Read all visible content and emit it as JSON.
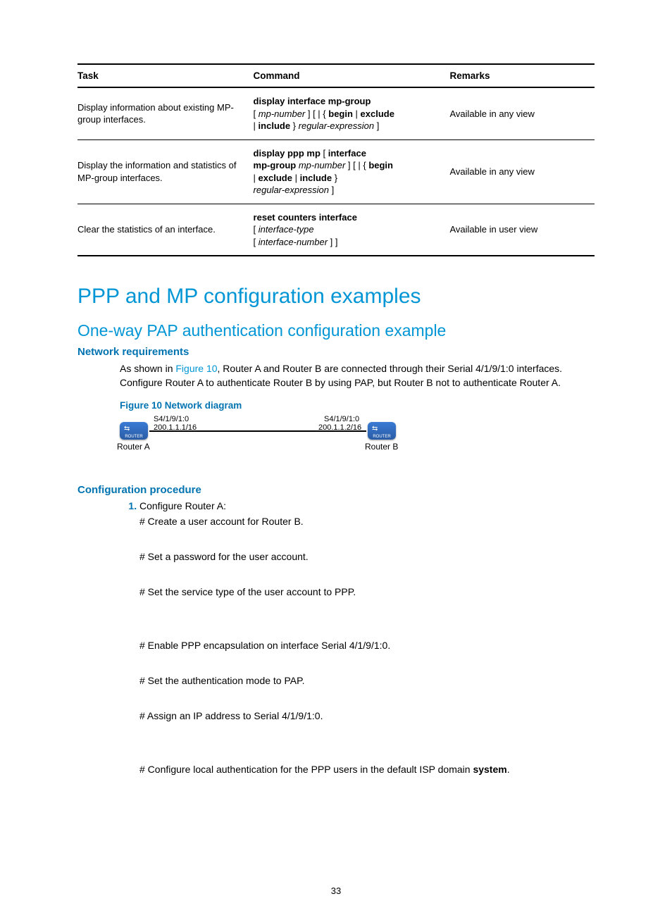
{
  "table": {
    "headers": [
      "Task",
      "Command",
      "Remarks"
    ],
    "rows": [
      {
        "task": "Display information about existing MP-group interfaces.",
        "remarks": "Available in any view",
        "cmd": {
          "p1b": "display interface mp-group",
          "p2a": "[ ",
          "p2i": "mp-number",
          "p2b": " ] [ | { ",
          "p2c": "begin",
          "p2d": " | ",
          "p2e": "exclude",
          "p3a": " | ",
          "p3b": "include",
          "p3c": " } ",
          "p3i": "regular-expression",
          "p3d": " ]"
        }
      },
      {
        "task": "Display the information and statistics of MP-group interfaces.",
        "remarks": "Available in any view",
        "cmd": {
          "p1b": "display ppp mp",
          "p1c": " [ ",
          "p1d": "interface",
          "p2a": "mp-group",
          "p2b": " ",
          "p2i": "mp-number",
          "p2c": " ] [ | { ",
          "p2d": "begin",
          "p3a": " | ",
          "p3b": "exclude",
          "p3c": " | ",
          "p3d": "include",
          "p3e": " }",
          "p4i": "regular-expression",
          "p4a": " ]"
        }
      },
      {
        "task": "Clear the statistics of an interface.",
        "remarks": "Available in user view",
        "cmd": {
          "p1b": "reset counters interface",
          "p2a": "[ ",
          "p2i": "interface-type",
          "p3a": "[ ",
          "p3i": "interface-number",
          "p3b": " ] ]"
        }
      }
    ]
  },
  "h1": "PPP and MP configuration examples",
  "h2": "One-way PAP authentication configuration example",
  "netreq_heading": "Network requirements",
  "netreq_text_a": "As shown in ",
  "netreq_figref": "Figure 10",
  "netreq_text_b": ", Router A and Router B are connected through their Serial 4/1/9/1:0 interfaces. Configure Router A to authenticate Router B by using PAP, but Router B not to authenticate Router A.",
  "figure_caption": "Figure 10 Network diagram",
  "diagram": {
    "a_if": "S4/1/9/1:0",
    "a_ip": "200.1.1.1/16",
    "b_if": "S4/1/9/1:0",
    "b_ip": "200.1.1.2/16",
    "router_a": "Router A",
    "router_b": "Router B"
  },
  "proc_heading": "Configuration procedure",
  "proc": {
    "item1": "Configure Router A:",
    "s1": "# Create a user account for Router B.",
    "s2": "# Set a password for the user account.",
    "s3": "# Set the service type of the user account to PPP.",
    "s4": "# Enable PPP encapsulation on interface Serial 4/1/9/1:0.",
    "s5": "# Set the authentication mode to PAP.",
    "s6": "# Assign an IP address to Serial 4/1/9/1:0.",
    "s7a": "# Configure local authentication for the PPP users in the default ISP domain ",
    "s7b": "system",
    "s7c": "."
  },
  "pagenum": "33"
}
